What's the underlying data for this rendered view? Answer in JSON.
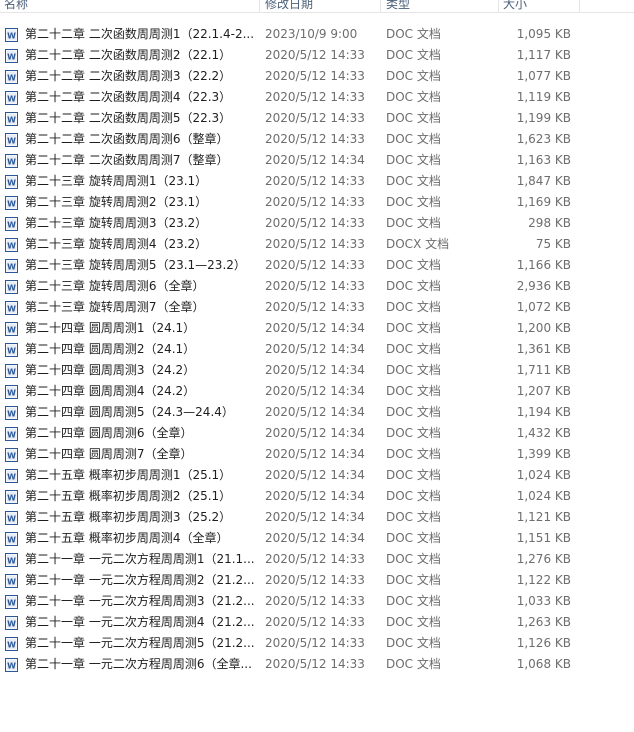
{
  "columns": {
    "name": "名称",
    "date": "修改日期",
    "type": "类型",
    "size": "大小"
  },
  "icon": "word-document-icon",
  "accent": "#2b5797",
  "files": [
    {
      "name": "第二十二章 二次函数周周测1（22.1.4-2...",
      "date": "2023/10/9 9:00",
      "type": "DOC 文档",
      "size": "1,095 KB"
    },
    {
      "name": "第二十二章 二次函数周周测2（22.1）",
      "date": "2020/5/12 14:33",
      "type": "DOC 文档",
      "size": "1,117 KB"
    },
    {
      "name": "第二十二章 二次函数周周测3（22.2）",
      "date": "2020/5/12 14:33",
      "type": "DOC 文档",
      "size": "1,077 KB"
    },
    {
      "name": "第二十二章 二次函数周周测4（22.3）",
      "date": "2020/5/12 14:33",
      "type": "DOC 文档",
      "size": "1,119 KB"
    },
    {
      "name": "第二十二章 二次函数周周测5（22.3）",
      "date": "2020/5/12 14:33",
      "type": "DOC 文档",
      "size": "1,199 KB"
    },
    {
      "name": "第二十二章 二次函数周周测6（整章）",
      "date": "2020/5/12 14:33",
      "type": "DOC 文档",
      "size": "1,623 KB"
    },
    {
      "name": "第二十二章 二次函数周周测7（整章）",
      "date": "2020/5/12 14:34",
      "type": "DOC 文档",
      "size": "1,163 KB"
    },
    {
      "name": "第二十三章  旋转周周测1（23.1）",
      "date": "2020/5/12 14:33",
      "type": "DOC 文档",
      "size": "1,847 KB"
    },
    {
      "name": "第二十三章  旋转周周测2（23.1）",
      "date": "2020/5/12 14:33",
      "type": "DOC 文档",
      "size": "1,169 KB"
    },
    {
      "name": "第二十三章  旋转周周测3（23.2）",
      "date": "2020/5/12 14:33",
      "type": "DOC 文档",
      "size": "298 KB"
    },
    {
      "name": "第二十三章  旋转周周测4（23.2）",
      "date": "2020/5/12 14:33",
      "type": "DOCX 文档",
      "size": "75 KB"
    },
    {
      "name": "第二十三章  旋转周周测5（23.1—23.2）",
      "date": "2020/5/12 14:33",
      "type": "DOC 文档",
      "size": "1,166 KB"
    },
    {
      "name": "第二十三章  旋转周周测6（全章）",
      "date": "2020/5/12 14:33",
      "type": "DOC 文档",
      "size": "2,936 KB"
    },
    {
      "name": "第二十三章 旋转周周测7（全章）",
      "date": "2020/5/12 14:33",
      "type": "DOC 文档",
      "size": "1,072 KB"
    },
    {
      "name": "第二十四章 圆周周测1（24.1）",
      "date": "2020/5/12 14:34",
      "type": "DOC 文档",
      "size": "1,200 KB"
    },
    {
      "name": "第二十四章 圆周周测2（24.1）",
      "date": "2020/5/12 14:34",
      "type": "DOC 文档",
      "size": "1,361 KB"
    },
    {
      "name": "第二十四章 圆周周测3（24.2）",
      "date": "2020/5/12 14:34",
      "type": "DOC 文档",
      "size": "1,711 KB"
    },
    {
      "name": "第二十四章 圆周周测4（24.2）",
      "date": "2020/5/12 14:34",
      "type": "DOC 文档",
      "size": "1,207 KB"
    },
    {
      "name": "第二十四章 圆周周测5（24.3—24.4）",
      "date": "2020/5/12 14:34",
      "type": "DOC 文档",
      "size": "1,194 KB"
    },
    {
      "name": "第二十四章 圆周周测6（全章）",
      "date": "2020/5/12 14:34",
      "type": "DOC 文档",
      "size": "1,432 KB"
    },
    {
      "name": "第二十四章 圆周周测7（全章）",
      "date": "2020/5/12 14:34",
      "type": "DOC 文档",
      "size": "1,399 KB"
    },
    {
      "name": "第二十五章 概率初步周周测1（25.1）",
      "date": "2020/5/12 14:34",
      "type": "DOC 文档",
      "size": "1,024 KB"
    },
    {
      "name": "第二十五章 概率初步周周测2（25.1）",
      "date": "2020/5/12 14:34",
      "type": "DOC 文档",
      "size": "1,024 KB"
    },
    {
      "name": "第二十五章 概率初步周周测3（25.2）",
      "date": "2020/5/12 14:34",
      "type": "DOC 文档",
      "size": "1,121 KB"
    },
    {
      "name": "第二十五章 概率初步周周测4（全章）",
      "date": "2020/5/12 14:34",
      "type": "DOC 文档",
      "size": "1,151 KB"
    },
    {
      "name": "第二十一章 一元二次方程周周测1（21.1...",
      "date": "2020/5/12 14:33",
      "type": "DOC 文档",
      "size": "1,276 KB"
    },
    {
      "name": "第二十一章 一元二次方程周周测2（21.2...",
      "date": "2020/5/12 14:33",
      "type": "DOC 文档",
      "size": "1,122 KB"
    },
    {
      "name": "第二十一章 一元二次方程周周测3（21.2...",
      "date": "2020/5/12 14:33",
      "type": "DOC 文档",
      "size": "1,033 KB"
    },
    {
      "name": "第二十一章 一元二次方程周周测4（21.2...",
      "date": "2020/5/12 14:33",
      "type": "DOC 文档",
      "size": "1,263 KB"
    },
    {
      "name": "第二十一章 一元二次方程周周测5（21.2...",
      "date": "2020/5/12 14:33",
      "type": "DOC 文档",
      "size": "1,126 KB"
    },
    {
      "name": "第二十一章 一元二次方程周周测6（全章...",
      "date": "2020/5/12 14:33",
      "type": "DOC 文档",
      "size": "1,068 KB"
    }
  ]
}
